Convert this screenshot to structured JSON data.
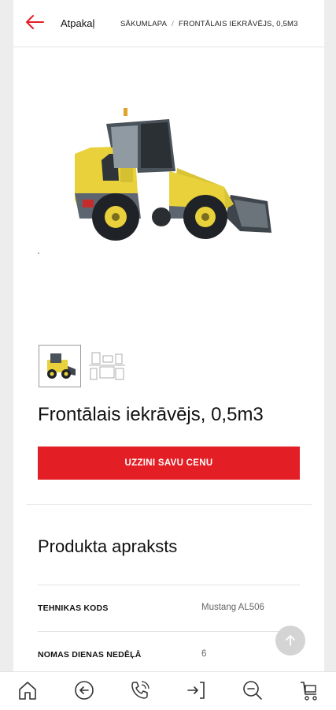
{
  "header": {
    "back_label": "Atpakaļ",
    "breadcrumb": {
      "home": "SĀKUMLAPA",
      "separator": "/",
      "current": "FRONTĀLAIS IEKRĀVĒJS, 0,5M3"
    }
  },
  "product": {
    "title": "Frontālais iekrāvējs, 0,5m3",
    "cta_label": "UZZINI SAVU CENU",
    "gallery": [
      "loader-photo",
      "loader-technical-drawing"
    ]
  },
  "description": {
    "heading": "Produkta apraksts",
    "specs": [
      {
        "label": "TEHNIKAS KODS",
        "value": "Mustang AL506"
      },
      {
        "label": "NOMAS DIENAS NEDĒĻĀ",
        "value": "6"
      }
    ]
  },
  "bottom_nav": {
    "items": [
      "home-icon",
      "back-circle-icon",
      "phone-icon",
      "login-icon",
      "search-icon",
      "cart-icon"
    ]
  },
  "colors": {
    "accent": "#e31e24",
    "machine_yellow": "#e8d13a",
    "machine_gray": "#5d6670"
  }
}
